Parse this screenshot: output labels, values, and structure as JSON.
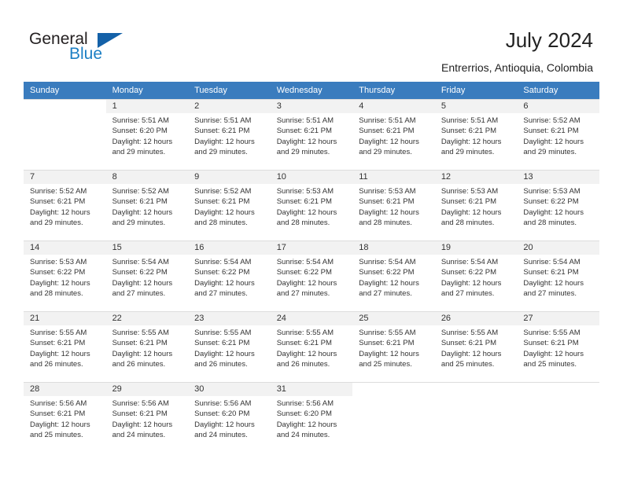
{
  "brand": {
    "name_part1": "General",
    "name_part2": "Blue",
    "triangle_icon": "triangle-icon",
    "colors": {
      "dark_text": "#231f20",
      "blue": "#1c7fc4",
      "triangle": "#1461a8"
    }
  },
  "header": {
    "title": "July 2024",
    "subtitle": "Entrerrios, Antioquia, Colombia"
  },
  "calendar": {
    "header_background": "#3a7cbe",
    "daynum_background": "#f2f2f2",
    "weekday_headers": [
      "Sunday",
      "Monday",
      "Tuesday",
      "Wednesday",
      "Thursday",
      "Friday",
      "Saturday"
    ],
    "weeks": [
      [
        {
          "day": "",
          "sunrise": "",
          "sunset": "",
          "daylight_line1": "",
          "daylight_line2": "",
          "blank": true
        },
        {
          "day": "1",
          "sunrise": "Sunrise: 5:51 AM",
          "sunset": "Sunset: 6:20 PM",
          "daylight_line1": "Daylight: 12 hours",
          "daylight_line2": "and 29 minutes.",
          "blank": false
        },
        {
          "day": "2",
          "sunrise": "Sunrise: 5:51 AM",
          "sunset": "Sunset: 6:21 PM",
          "daylight_line1": "Daylight: 12 hours",
          "daylight_line2": "and 29 minutes.",
          "blank": false
        },
        {
          "day": "3",
          "sunrise": "Sunrise: 5:51 AM",
          "sunset": "Sunset: 6:21 PM",
          "daylight_line1": "Daylight: 12 hours",
          "daylight_line2": "and 29 minutes.",
          "blank": false
        },
        {
          "day": "4",
          "sunrise": "Sunrise: 5:51 AM",
          "sunset": "Sunset: 6:21 PM",
          "daylight_line1": "Daylight: 12 hours",
          "daylight_line2": "and 29 minutes.",
          "blank": false
        },
        {
          "day": "5",
          "sunrise": "Sunrise: 5:51 AM",
          "sunset": "Sunset: 6:21 PM",
          "daylight_line1": "Daylight: 12 hours",
          "daylight_line2": "and 29 minutes.",
          "blank": false
        },
        {
          "day": "6",
          "sunrise": "Sunrise: 5:52 AM",
          "sunset": "Sunset: 6:21 PM",
          "daylight_line1": "Daylight: 12 hours",
          "daylight_line2": "and 29 minutes.",
          "blank": false
        }
      ],
      [
        {
          "day": "7",
          "sunrise": "Sunrise: 5:52 AM",
          "sunset": "Sunset: 6:21 PM",
          "daylight_line1": "Daylight: 12 hours",
          "daylight_line2": "and 29 minutes.",
          "blank": false
        },
        {
          "day": "8",
          "sunrise": "Sunrise: 5:52 AM",
          "sunset": "Sunset: 6:21 PM",
          "daylight_line1": "Daylight: 12 hours",
          "daylight_line2": "and 29 minutes.",
          "blank": false
        },
        {
          "day": "9",
          "sunrise": "Sunrise: 5:52 AM",
          "sunset": "Sunset: 6:21 PM",
          "daylight_line1": "Daylight: 12 hours",
          "daylight_line2": "and 28 minutes.",
          "blank": false
        },
        {
          "day": "10",
          "sunrise": "Sunrise: 5:53 AM",
          "sunset": "Sunset: 6:21 PM",
          "daylight_line1": "Daylight: 12 hours",
          "daylight_line2": "and 28 minutes.",
          "blank": false
        },
        {
          "day": "11",
          "sunrise": "Sunrise: 5:53 AM",
          "sunset": "Sunset: 6:21 PM",
          "daylight_line1": "Daylight: 12 hours",
          "daylight_line2": "and 28 minutes.",
          "blank": false
        },
        {
          "day": "12",
          "sunrise": "Sunrise: 5:53 AM",
          "sunset": "Sunset: 6:21 PM",
          "daylight_line1": "Daylight: 12 hours",
          "daylight_line2": "and 28 minutes.",
          "blank": false
        },
        {
          "day": "13",
          "sunrise": "Sunrise: 5:53 AM",
          "sunset": "Sunset: 6:22 PM",
          "daylight_line1": "Daylight: 12 hours",
          "daylight_line2": "and 28 minutes.",
          "blank": false
        }
      ],
      [
        {
          "day": "14",
          "sunrise": "Sunrise: 5:53 AM",
          "sunset": "Sunset: 6:22 PM",
          "daylight_line1": "Daylight: 12 hours",
          "daylight_line2": "and 28 minutes.",
          "blank": false
        },
        {
          "day": "15",
          "sunrise": "Sunrise: 5:54 AM",
          "sunset": "Sunset: 6:22 PM",
          "daylight_line1": "Daylight: 12 hours",
          "daylight_line2": "and 27 minutes.",
          "blank": false
        },
        {
          "day": "16",
          "sunrise": "Sunrise: 5:54 AM",
          "sunset": "Sunset: 6:22 PM",
          "daylight_line1": "Daylight: 12 hours",
          "daylight_line2": "and 27 minutes.",
          "blank": false
        },
        {
          "day": "17",
          "sunrise": "Sunrise: 5:54 AM",
          "sunset": "Sunset: 6:22 PM",
          "daylight_line1": "Daylight: 12 hours",
          "daylight_line2": "and 27 minutes.",
          "blank": false
        },
        {
          "day": "18",
          "sunrise": "Sunrise: 5:54 AM",
          "sunset": "Sunset: 6:22 PM",
          "daylight_line1": "Daylight: 12 hours",
          "daylight_line2": "and 27 minutes.",
          "blank": false
        },
        {
          "day": "19",
          "sunrise": "Sunrise: 5:54 AM",
          "sunset": "Sunset: 6:22 PM",
          "daylight_line1": "Daylight: 12 hours",
          "daylight_line2": "and 27 minutes.",
          "blank": false
        },
        {
          "day": "20",
          "sunrise": "Sunrise: 5:54 AM",
          "sunset": "Sunset: 6:21 PM",
          "daylight_line1": "Daylight: 12 hours",
          "daylight_line2": "and 27 minutes.",
          "blank": false
        }
      ],
      [
        {
          "day": "21",
          "sunrise": "Sunrise: 5:55 AM",
          "sunset": "Sunset: 6:21 PM",
          "daylight_line1": "Daylight: 12 hours",
          "daylight_line2": "and 26 minutes.",
          "blank": false
        },
        {
          "day": "22",
          "sunrise": "Sunrise: 5:55 AM",
          "sunset": "Sunset: 6:21 PM",
          "daylight_line1": "Daylight: 12 hours",
          "daylight_line2": "and 26 minutes.",
          "blank": false
        },
        {
          "day": "23",
          "sunrise": "Sunrise: 5:55 AM",
          "sunset": "Sunset: 6:21 PM",
          "daylight_line1": "Daylight: 12 hours",
          "daylight_line2": "and 26 minutes.",
          "blank": false
        },
        {
          "day": "24",
          "sunrise": "Sunrise: 5:55 AM",
          "sunset": "Sunset: 6:21 PM",
          "daylight_line1": "Daylight: 12 hours",
          "daylight_line2": "and 26 minutes.",
          "blank": false
        },
        {
          "day": "25",
          "sunrise": "Sunrise: 5:55 AM",
          "sunset": "Sunset: 6:21 PM",
          "daylight_line1": "Daylight: 12 hours",
          "daylight_line2": "and 25 minutes.",
          "blank": false
        },
        {
          "day": "26",
          "sunrise": "Sunrise: 5:55 AM",
          "sunset": "Sunset: 6:21 PM",
          "daylight_line1": "Daylight: 12 hours",
          "daylight_line2": "and 25 minutes.",
          "blank": false
        },
        {
          "day": "27",
          "sunrise": "Sunrise: 5:55 AM",
          "sunset": "Sunset: 6:21 PM",
          "daylight_line1": "Daylight: 12 hours",
          "daylight_line2": "and 25 minutes.",
          "blank": false
        }
      ],
      [
        {
          "day": "28",
          "sunrise": "Sunrise: 5:56 AM",
          "sunset": "Sunset: 6:21 PM",
          "daylight_line1": "Daylight: 12 hours",
          "daylight_line2": "and 25 minutes.",
          "blank": false
        },
        {
          "day": "29",
          "sunrise": "Sunrise: 5:56 AM",
          "sunset": "Sunset: 6:21 PM",
          "daylight_line1": "Daylight: 12 hours",
          "daylight_line2": "and 24 minutes.",
          "blank": false
        },
        {
          "day": "30",
          "sunrise": "Sunrise: 5:56 AM",
          "sunset": "Sunset: 6:20 PM",
          "daylight_line1": "Daylight: 12 hours",
          "daylight_line2": "and 24 minutes.",
          "blank": false
        },
        {
          "day": "31",
          "sunrise": "Sunrise: 5:56 AM",
          "sunset": "Sunset: 6:20 PM",
          "daylight_line1": "Daylight: 12 hours",
          "daylight_line2": "and 24 minutes.",
          "blank": false
        },
        {
          "day": "",
          "sunrise": "",
          "sunset": "",
          "daylight_line1": "",
          "daylight_line2": "",
          "blank": true
        },
        {
          "day": "",
          "sunrise": "",
          "sunset": "",
          "daylight_line1": "",
          "daylight_line2": "",
          "blank": true
        },
        {
          "day": "",
          "sunrise": "",
          "sunset": "",
          "daylight_line1": "",
          "daylight_line2": "",
          "blank": true
        }
      ]
    ]
  }
}
